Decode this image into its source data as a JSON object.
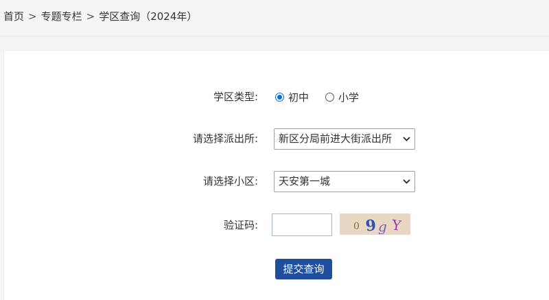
{
  "breadcrumb": {
    "items": [
      "首页",
      "专题专栏",
      "学区查询（2024年）"
    ],
    "separator": ">"
  },
  "form": {
    "district_type": {
      "label": "学区类型:",
      "options": [
        {
          "label": "初中",
          "checked": true
        },
        {
          "label": "小学",
          "checked": false
        }
      ]
    },
    "police_station": {
      "label": "请选择派出所:",
      "selected": "新区分局前进大街派出所"
    },
    "community": {
      "label": "请选择小区:",
      "selected": "天安第一城"
    },
    "captcha": {
      "label": "验证码:",
      "value": "",
      "image_text": "09gY"
    },
    "submit_label": "提交查询"
  },
  "colors": {
    "accent": "#0a6ed1",
    "button": "#1f4f9c",
    "captcha_bg": "#e7d8c4",
    "page_bg": "#f5f5f5"
  },
  "icons": {
    "select_arrow": "chevron-down-icon"
  }
}
